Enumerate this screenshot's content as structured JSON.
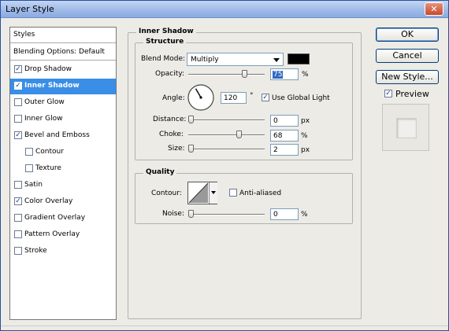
{
  "window": {
    "title": "Layer Style",
    "close_glyph": "✕"
  },
  "styles": {
    "header": "Styles",
    "blending": "Blending Options: Default",
    "items": [
      {
        "label": "Drop Shadow",
        "checked": true
      },
      {
        "label": "Inner Shadow",
        "checked": true,
        "selected": true
      },
      {
        "label": "Outer Glow",
        "checked": false
      },
      {
        "label": "Inner Glow",
        "checked": false
      },
      {
        "label": "Bevel and Emboss",
        "checked": true
      },
      {
        "label": "Contour",
        "checked": false,
        "indent": true
      },
      {
        "label": "Texture",
        "checked": false,
        "indent": true
      },
      {
        "label": "Satin",
        "checked": false
      },
      {
        "label": "Color Overlay",
        "checked": true
      },
      {
        "label": "Gradient Overlay",
        "checked": false
      },
      {
        "label": "Pattern Overlay",
        "checked": false
      },
      {
        "label": "Stroke",
        "checked": false
      }
    ]
  },
  "inner_shadow": {
    "title": "Inner Shadow",
    "structure": {
      "title": "Structure",
      "blend_mode_label": "Blend Mode:",
      "blend_mode_value": "Multiply",
      "shadow_color": "#000000",
      "opacity_label": "Opacity:",
      "opacity_value": "75",
      "opacity_unit": "%",
      "angle_label": "Angle:",
      "angle_value": "120",
      "angle_unit": "°",
      "global_light_label": "Use Global Light",
      "global_light_checked": true,
      "distance_label": "Distance:",
      "distance_value": "0",
      "distance_unit": "px",
      "choke_label": "Choke:",
      "choke_value": "68",
      "choke_unit": "%",
      "size_label": "Size:",
      "size_value": "2",
      "size_unit": "px"
    },
    "quality": {
      "title": "Quality",
      "contour_label": "Contour:",
      "anti_aliased_label": "Anti-aliased",
      "anti_aliased_checked": false,
      "noise_label": "Noise:",
      "noise_value": "0",
      "noise_unit": "%"
    }
  },
  "buttons": {
    "ok": "OK",
    "cancel": "Cancel",
    "new_style": "New Style...",
    "preview_label": "Preview",
    "preview_checked": true
  },
  "check_glyph": "✓"
}
